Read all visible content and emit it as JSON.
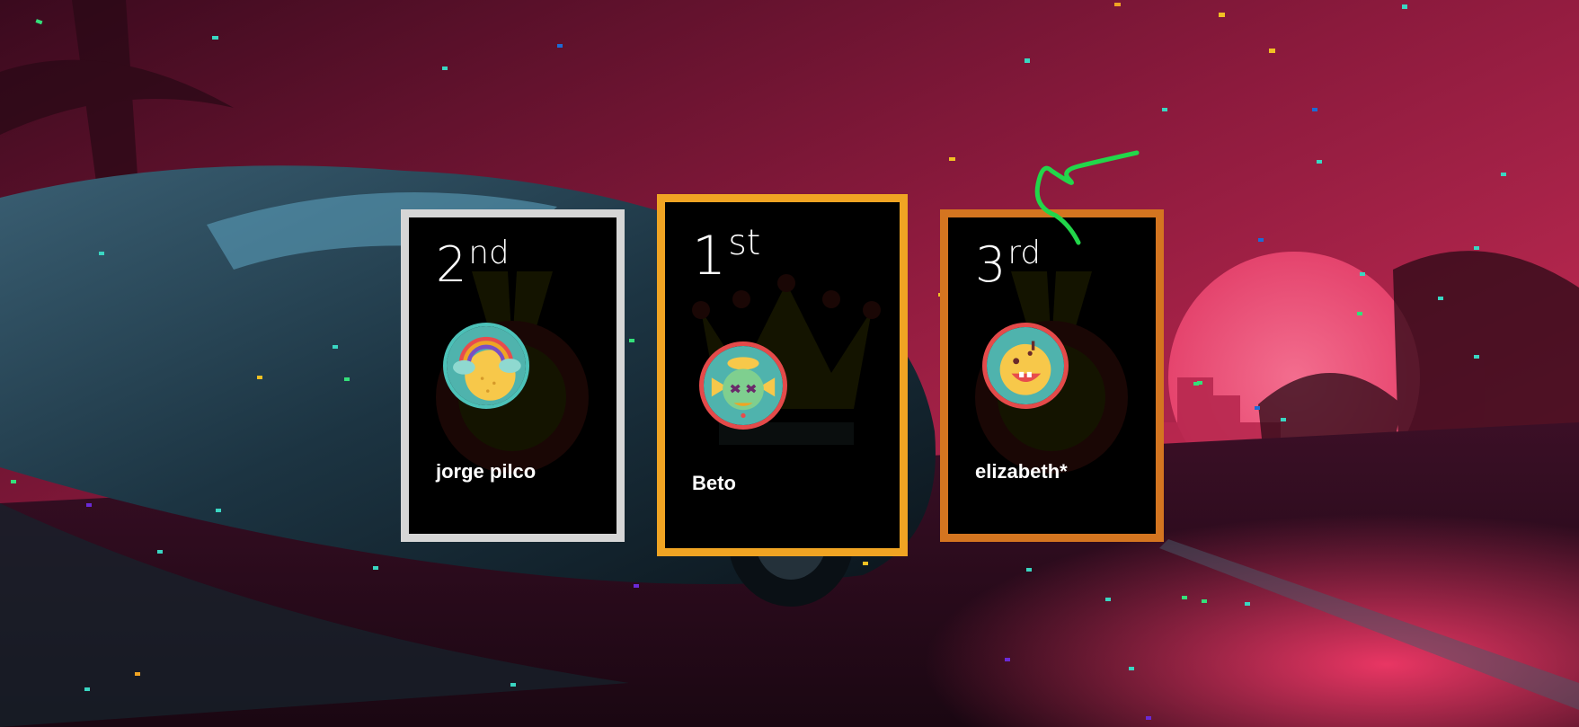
{
  "podium": {
    "first": {
      "place_number": "1",
      "place_suffix": "st",
      "name": "Beto",
      "avatar_icon": "skull-fish-avatar-icon",
      "border_color": "#f0a423"
    },
    "second": {
      "place_number": "2",
      "place_suffix": "nd",
      "name": "jorge pilco",
      "avatar_icon": "rainbow-sun-avatar-icon",
      "border_color": "#d6d6d6"
    },
    "third": {
      "place_number": "3",
      "place_suffix": "rd",
      "name": "elizabeth*",
      "avatar_icon": "smiling-monster-avatar-icon",
      "border_color": "#d47520"
    }
  },
  "background": {
    "scene": "neon-car-sunset-background"
  }
}
